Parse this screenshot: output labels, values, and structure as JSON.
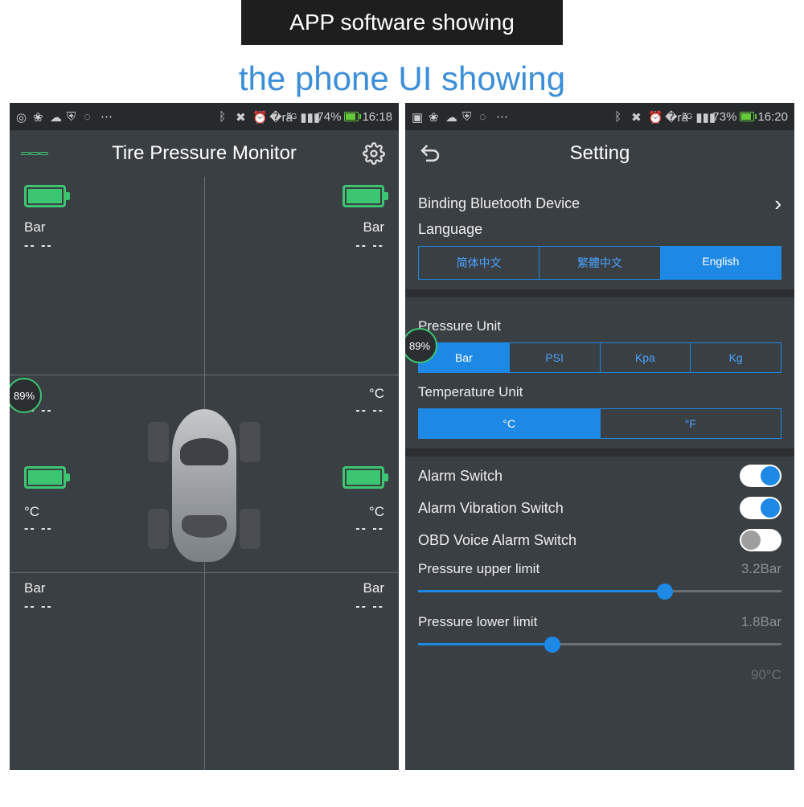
{
  "banner_dark": "APP software showing",
  "banner_blue": "the phone UI showing",
  "status_left": {
    "battery_pct": "74%",
    "time": "16:18",
    "net": "2G"
  },
  "status_right": {
    "battery_pct": "73%",
    "time": "16:20",
    "net": "2G"
  },
  "monitor": {
    "title": "Tire Pressure Monitor",
    "badge": "89%",
    "tiles": {
      "fl": {
        "unit_p": "Bar",
        "val_p": "-- --",
        "unit_t": "°C",
        "val_t": "-- --"
      },
      "fr": {
        "unit_p": "Bar",
        "val_p": "-- --",
        "unit_t": "°C",
        "val_t": "-- --"
      },
      "rl": {
        "unit_p": "°C",
        "val_p": "-- --",
        "unit_t": "Bar",
        "val_t": "-- --"
      },
      "rr": {
        "unit_p": "°C",
        "val_p": "-- --",
        "unit_t": "Bar",
        "val_t": "-- --"
      }
    }
  },
  "settings": {
    "title": "Setting",
    "bind_device": "Binding Bluetooth Device",
    "language_label": "Language",
    "language_opts": [
      "简体中文",
      "繁體中文",
      "English"
    ],
    "language_selected": 2,
    "pressure_unit_label": "Pressure Unit",
    "pressure_opts": [
      "Bar",
      "PSI",
      "Kpa",
      "Kg"
    ],
    "pressure_selected": 0,
    "temp_unit_label": "Temperature Unit",
    "temp_opts": [
      "°C",
      "°F"
    ],
    "temp_selected": 0,
    "badge": "89%",
    "switches": {
      "alarm": {
        "label": "Alarm Switch",
        "on": true
      },
      "vibration": {
        "label": "Alarm Vibration Switch",
        "on": true
      },
      "obd": {
        "label": "OBD Voice Alarm Switch",
        "on": false
      }
    },
    "upper": {
      "label": "Pressure upper limit",
      "value": "3.2Bar",
      "pct": 68
    },
    "lower": {
      "label": "Pressure lower limit",
      "value": "1.8Bar",
      "pct": 37
    },
    "temp_upper_value": "90°C"
  }
}
